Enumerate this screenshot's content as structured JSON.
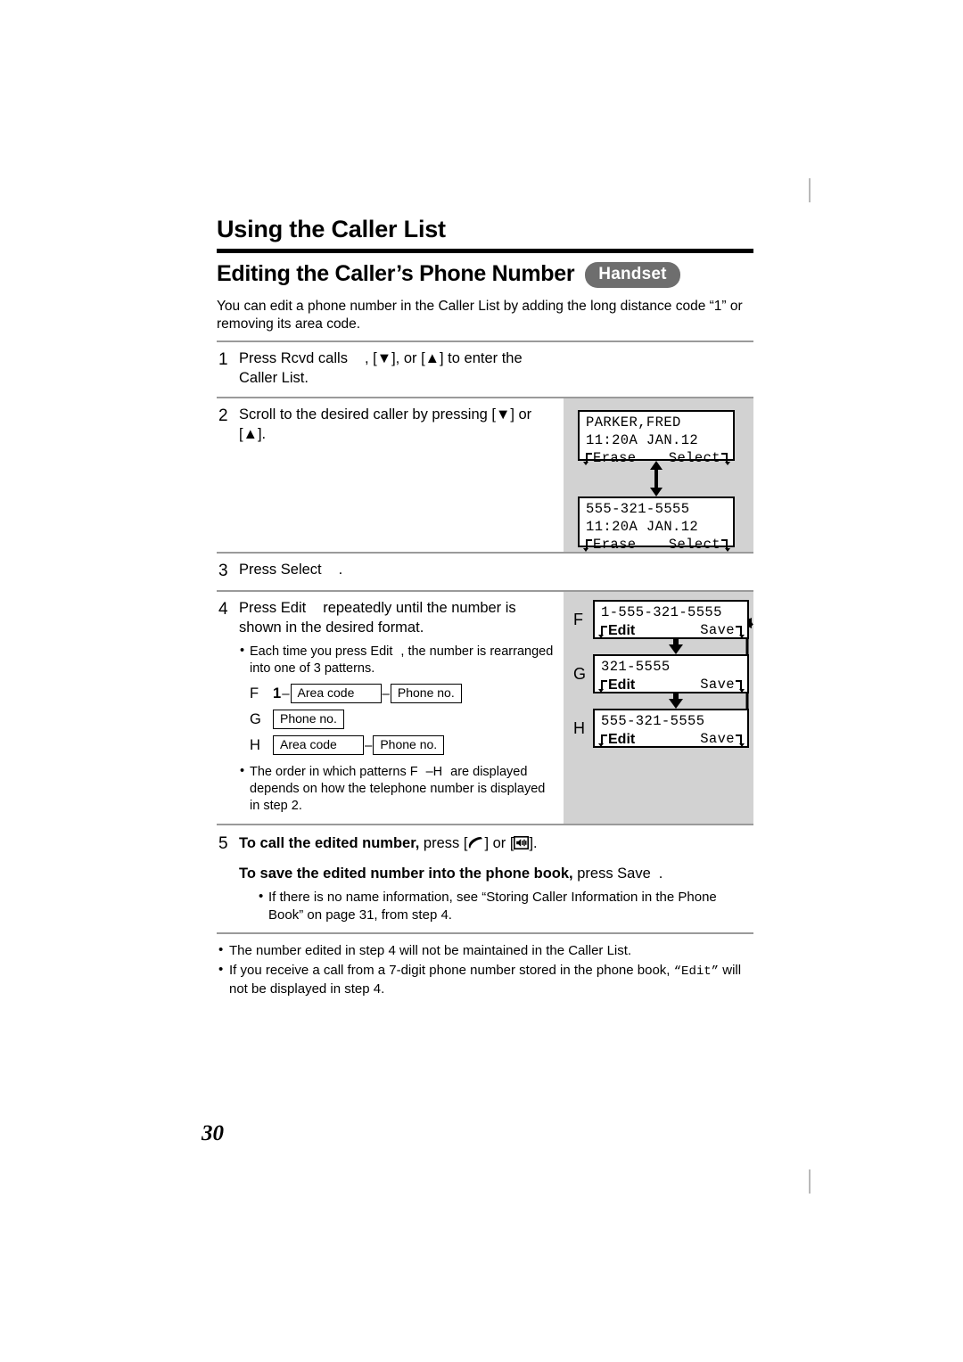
{
  "page": {
    "number": "30"
  },
  "header": {
    "chapter_title": "Using the Caller List",
    "section_title": "Editing the Caller’s Phone Number",
    "device_badge": "Handset",
    "intro": "You can edit a phone number in the Caller List by adding the long distance code “1” or removing its area code."
  },
  "steps": [
    {
      "number": "1",
      "text_a": "Press Rcvd calls",
      "text_b": ", [",
      "key1": "▼",
      "text_c": "], or [",
      "key2": "▲",
      "text_d": "] to enter the Caller List."
    },
    {
      "number": "2",
      "text_a": "Scroll to the desired caller by pressing [",
      "key1": "▼",
      "text_b": "] or [",
      "key2": "▲",
      "text_c": "]."
    },
    {
      "number": "3",
      "text_a": "Press Select",
      "text_b": "."
    },
    {
      "number": "4",
      "text_a": "Press Edit",
      "text_b": "repeatedly until the number is shown in the desired format.",
      "bullet1_a": "Each time you press Edit",
      "bullet1_b": ", the number is rearranged into one of 3 patterns.",
      "bullet2_a": "The order in which patterns F",
      "bullet2_b": "–H",
      "bullet2_c": "are displayed depends on how the telephone number is displayed in step 2."
    },
    {
      "number": "5",
      "line1_bold": "To call the edited number,",
      "line1_a": "press [",
      "line1_b": "] or [",
      "line1_c": "].",
      "line2_bold": "To save the edited number into the phone book,",
      "line2_a": "press Save",
      "line2_b": ".",
      "bullet1": "If there is no name information, see “Storing Caller Information in the Phone Book” on page 31, from step 4."
    }
  ],
  "patterns": {
    "rows": [
      {
        "letter": "F",
        "prefix": "1",
        "dash1": "–",
        "box1": "Area code",
        "dash2": "–",
        "box2": "Phone no."
      },
      {
        "letter": "G",
        "prefix": "",
        "dash1": "",
        "box1": "Phone no.",
        "dash2": "",
        "box2": ""
      },
      {
        "letter": "H",
        "prefix": "",
        "dash1": "",
        "box1": "Area code",
        "dash2": "–",
        "box2": "Phone no."
      }
    ]
  },
  "lcd_step2": [
    {
      "line1": "PARKER,FRED",
      "line2": "11:20A JAN.12",
      "softkey_left": "Erase",
      "softkey_right": "Select"
    },
    {
      "line1": "555-321-5555",
      "line2": "11:20A JAN.12",
      "softkey_left": "Erase",
      "softkey_right": "Select"
    }
  ],
  "lcd_step4": [
    {
      "letter": "F",
      "line1": "1-555-321-5555",
      "softkey_left": "Edit",
      "softkey_right": "Save"
    },
    {
      "letter": "G",
      "line1": "321-5555",
      "softkey_left": "Edit",
      "softkey_right": "Save"
    },
    {
      "letter": "H",
      "line1": "555-321-5555",
      "softkey_left": "Edit",
      "softkey_right": "Save"
    }
  ],
  "notes": [
    "The number edited in step 4 will not be maintained in the Caller List.",
    "If you receive a call from a 7-digit phone number stored in the phone book, “Edit” will not be displayed in step 4."
  ],
  "notes_inline": {
    "note2_a": "If you receive a call from a 7-digit phone number stored in the phone book,",
    "note2_mono": "“Edit”",
    "note2_b": "will not be displayed in step 4."
  },
  "colors": {
    "panel_gray": "#d2d2d2",
    "badge_gray": "#6e6e6e",
    "rule": "#9a9a9a"
  }
}
